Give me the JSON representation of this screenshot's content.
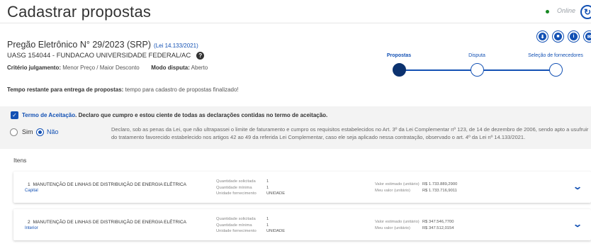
{
  "header": {
    "page_title": "Cadastrar propostas",
    "online_label": "Online"
  },
  "pregao": {
    "title": "Pregão Eletrônico N° 29/2023 (SRP)",
    "lei": "(Lei 14.133/2021)",
    "uasg": "UASG 154044 - FUNDACAO UNIVERSIDADE FEDERAL/AC",
    "criterio_label": "Critério julgamento:",
    "criterio_value": "Menor Preço / Maior Desconto",
    "modo_label": "Modo disputa:",
    "modo_value": "Aberto",
    "tempo_label": "Tempo restante para entrega de propostas:",
    "tempo_value": "tempo para cadastro de propostas finalizado!"
  },
  "stepper": {
    "steps": [
      {
        "label": "Propostas",
        "active": true
      },
      {
        "label": "Disputa",
        "active": false
      },
      {
        "label": "Seleção de fornecedores",
        "active": false
      }
    ]
  },
  "toolbar_icons": [
    "download-icon",
    "trash-icon",
    "info-icon",
    "mail-icon"
  ],
  "termo": {
    "link": "Termo de Aceitação",
    "text": "Declaro que cumpro e estou ciente de todas as declarações contidas no termo de aceitação.",
    "sim": "Sim",
    "nao": "Não",
    "selected": "Não",
    "declaro": "Declaro, sob as penas da Lei, que não ultrapassei o limite de faturamento e cumpro os requisitos estabelecidos no Art. 3º da Lei Complementar nº 123, de 14 de dezembro de 2006, sendo apto a usufruir do tratamento favorecido estabelecido nos artigos 42 ao 49 da referida Lei Complementar, caso ele seja aplicado nessa contratação, observado o art. 4º da Lei nº 14.133/2021."
  },
  "itens": {
    "title": "Itens",
    "labels": {
      "qtd_solicitada": "Quantidade solicitada",
      "qtd_minima": "Quantidade mínima",
      "unidade": "Unidade fornecimento",
      "valor_estimado": "Valor estimado (unitário)",
      "meu_valor": "Meu valor (unitário)"
    },
    "rows": [
      {
        "num": "1",
        "desc": "MANUTENÇÃO DE LINHAS DE DISTRIBUIÇÃO DE ENERGIA ELÉTRICA",
        "regiao": "Capital",
        "qtd_solicitada": "1",
        "qtd_minima": "1",
        "unidade": "UNIDADE",
        "valor_estimado": "R$ 1.733.889,2900",
        "meu_valor": "R$ 1.733.716,9011"
      },
      {
        "num": "2",
        "desc": "MANUTENÇÃO DE LINHAS DE DISTRIBUIÇÃO DE ENERGIA ELÉTRICA",
        "regiao": "Interior",
        "qtd_solicitada": "1",
        "qtd_minima": "1",
        "unidade": "UNIDADE",
        "valor_estimado": "R$ 347.546,7700",
        "meu_valor": "R$ 347.512,0154"
      }
    ]
  }
}
